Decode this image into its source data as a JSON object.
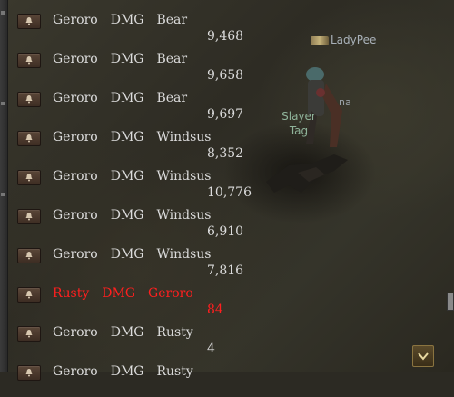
{
  "chat_log": {
    "entries": [
      {
        "attacker": "Geroro",
        "tag": "DMG",
        "target": "Bear",
        "value": "9,468",
        "color": "normal"
      },
      {
        "attacker": "Geroro",
        "tag": "DMG",
        "target": "Bear",
        "value": "9,658",
        "color": "normal"
      },
      {
        "attacker": "Geroro",
        "tag": "DMG",
        "target": "Bear",
        "value": "9,697",
        "color": "normal"
      },
      {
        "attacker": "Geroro",
        "tag": "DMG",
        "target": "Windsus",
        "value": "8,352",
        "color": "normal"
      },
      {
        "attacker": "Geroro",
        "tag": "DMG",
        "target": "Windsus",
        "value": "10,776",
        "color": "normal"
      },
      {
        "attacker": "Geroro",
        "tag": "DMG",
        "target": "Windsus",
        "value": "6,910",
        "color": "normal"
      },
      {
        "attacker": "Geroro",
        "tag": "DMG",
        "target": "Windsus",
        "value": "7,816",
        "color": "normal"
      },
      {
        "attacker": "Rusty",
        "tag": "DMG",
        "target": "Geroro",
        "value": "84",
        "color": "red"
      },
      {
        "attacker": "Geroro",
        "tag": "DMG",
        "target": "Rusty",
        "value": "4",
        "color": "normal"
      },
      {
        "attacker": "Geroro",
        "tag": "DMG",
        "target": "Rusty",
        "value": "",
        "color": "normal"
      }
    ],
    "icon": "bell-icon",
    "text_color": "#dcdcdc",
    "highlight_color": "#ff1f1f"
  },
  "world": {
    "player_name": "LadyPee",
    "npc_name_line1": "Slayer",
    "npc_name_line2": "Tag",
    "partial_label": "na"
  },
  "controls": {
    "collapse_icon": "chevron-down-icon"
  }
}
